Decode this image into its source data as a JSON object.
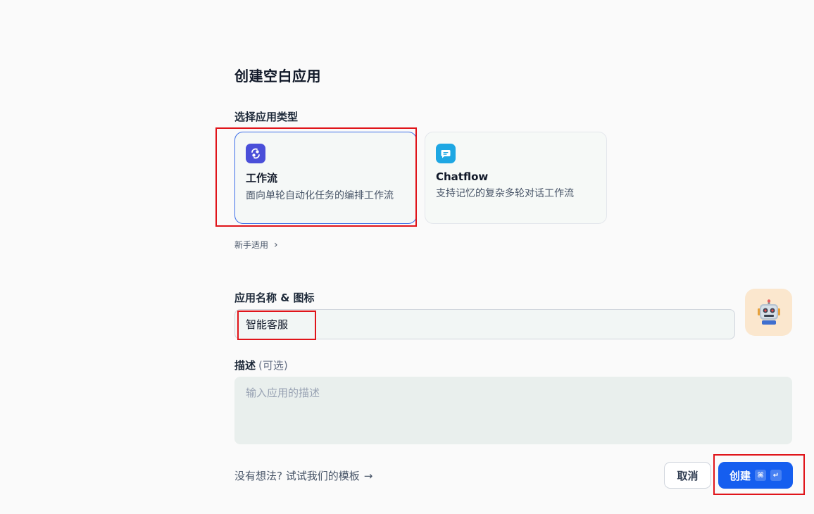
{
  "dialog": {
    "title": "创建空白应用",
    "app_type_label": "选择应用类型",
    "app_types": [
      {
        "title": "工作流",
        "description": "面向单轮自动化任务的编排工作流",
        "icon": "workflow-icon",
        "color": "#4a4fd9",
        "selected": true
      },
      {
        "title": "Chatflow",
        "description": "支持记忆的复杂多轮对话工作流",
        "icon": "chat-icon",
        "color": "#1ea7e3",
        "selected": false
      }
    ],
    "beginner_label": "新手适用",
    "name_icon_label": "应用名称 & 图标",
    "name_value": "智能客服",
    "avatar_icon": "robot-icon",
    "description_label": "描述",
    "description_optional": "(可选)",
    "description_placeholder": "输入应用的描述",
    "templates_link": "没有想法? 试试我们的模板",
    "cancel_label": "取消",
    "create_label": "创建",
    "create_shortcut_cmd": "⌘",
    "create_shortcut_enter": "↵"
  },
  "colors": {
    "accent": "#155eef",
    "selected_border": "#3d6ee8",
    "highlight_box": "#e0141a"
  }
}
